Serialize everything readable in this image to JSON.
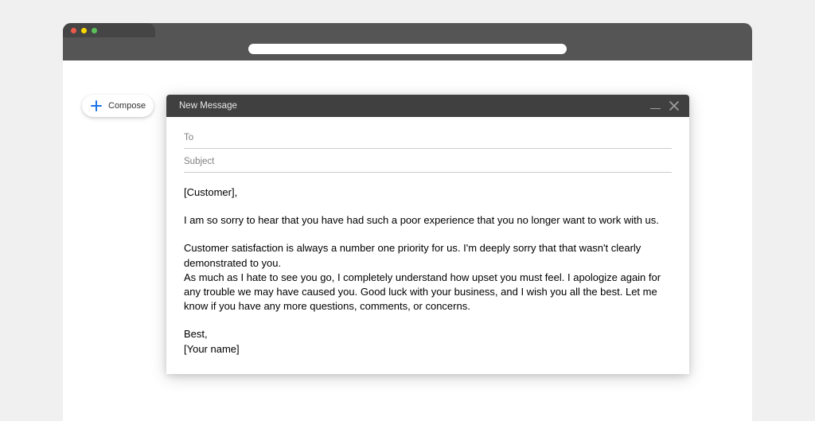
{
  "compose": {
    "label": "Compose"
  },
  "message": {
    "header_title": "New Message",
    "to_label": "To",
    "subject_label": "Subject",
    "body": {
      "greeting": "[Customer],",
      "p1": "I am so sorry to hear that you have had such a poor experience that you no longer want to work with us.",
      "p2a": "Customer satisfaction is always a number one priority for us. I'm deeply sorry that that wasn't clearly demonstrated to you.",
      "p2b": "As much as I hate to see you go, I completely understand how upset you must feel. I apologize again for any trouble we may have caused you. Good luck with your business, and I wish you all the best. Let me know if you have any more questions, comments, or concerns.",
      "closing": "Best,",
      "signature": "[Your name]"
    }
  }
}
